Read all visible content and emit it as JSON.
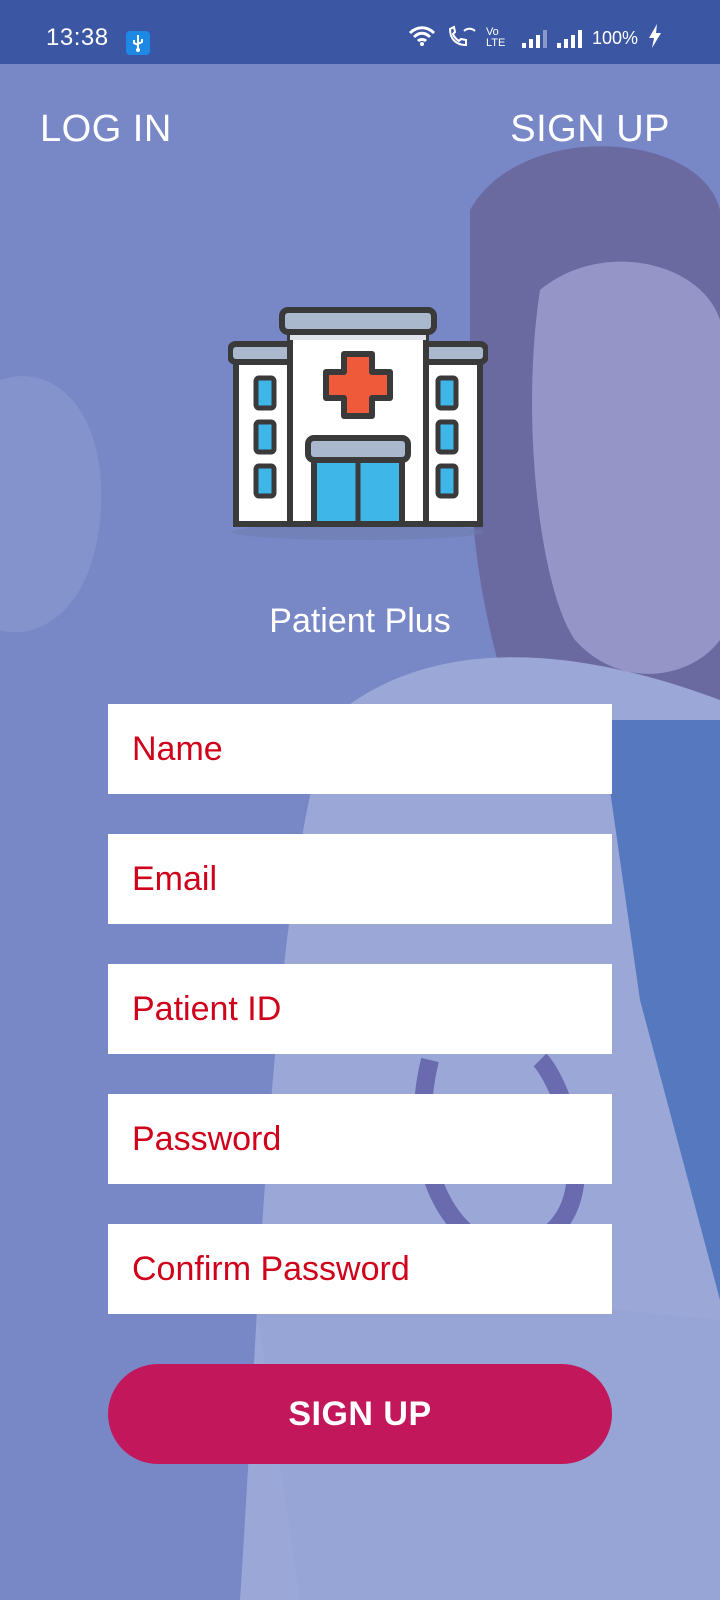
{
  "status_bar": {
    "time": "13:38",
    "battery": "100%",
    "volte_label": "Vo LTE"
  },
  "nav": {
    "login_label": "LOG IN",
    "signup_label": "SIGN UP"
  },
  "app": {
    "name": "Patient Plus"
  },
  "form": {
    "name_placeholder": "Name",
    "email_placeholder": "Email",
    "patient_id_placeholder": "Patient ID",
    "password_placeholder": "Password",
    "confirm_password_placeholder": "Confirm Password",
    "submit_label": "SIGN UP"
  },
  "colors": {
    "status_bar": "#3b56a3",
    "overlay": "#7f8fc7",
    "placeholder_text": "#d0021b",
    "button": "#c2185b"
  },
  "icons": [
    "usb-icon",
    "wifi-icon",
    "wifi-call-icon",
    "signal-icon",
    "battery-charging-icon",
    "hospital-logo-icon"
  ]
}
